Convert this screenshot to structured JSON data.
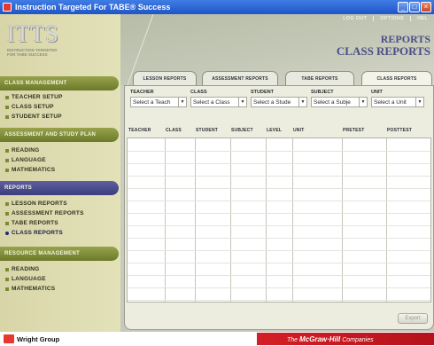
{
  "window": {
    "title": "Instruction Targeted For TABE® Success",
    "minimize": "_",
    "maximize": "□",
    "close": "×"
  },
  "logo": {
    "big": "ITTS",
    "sub_line1": "INSTRUCTION TARGETED",
    "sub_line2": "FOR TABE SUCCESS"
  },
  "sidebar": {
    "sections": [
      {
        "header": "CLASS MANAGEMENT",
        "items": [
          "TEACHER SETUP",
          "CLASS SETUP",
          "STUDENT SETUP"
        ]
      },
      {
        "header": "ASSESSMENT AND STUDY PLAN",
        "items": [
          "READING",
          "LANGUAGE",
          "MATHEMATICS"
        ]
      },
      {
        "header": "REPORTS",
        "items": [
          "LESSON REPORTS",
          "ASSESSMENT REPORTS",
          "TABE REPORTS",
          "CLASS REPORTS"
        ]
      },
      {
        "header": "RESOURCE MANAGEMENT",
        "items": [
          "READING",
          "LANGUAGE",
          "MATHEMATICS"
        ]
      }
    ]
  },
  "top_links": [
    "LOG OUT",
    "OPTIONS",
    "HEL"
  ],
  "page_title": {
    "line1": "REPORTS",
    "line2": "CLASS REPORTS"
  },
  "tabs": [
    "LESSON REPORTS",
    "ASSESSMENT REPORTS",
    "TABE REPORTS",
    "CLASS REPORTS"
  ],
  "filters": [
    {
      "label": "TEACHER",
      "value": "Select a Teach"
    },
    {
      "label": "CLASS",
      "value": "Select a Class"
    },
    {
      "label": "STUDENT",
      "value": "Select a Stude"
    },
    {
      "label": "SUBJECT",
      "value": "Select a Subje"
    },
    {
      "label": "UNIT",
      "value": "Select a Unit"
    }
  ],
  "grid_columns": [
    "TEACHER",
    "CLASS",
    "STUDENT",
    "SUBJECT",
    "LEVEL",
    "UNIT",
    "PRETEST",
    "POSTTEST"
  ],
  "export_label": "Export",
  "footer": {
    "publisher": "Wright Group",
    "banner_prefix": "The",
    "banner_brand": "McGraw·Hill",
    "banner_suffix": "Companies"
  }
}
